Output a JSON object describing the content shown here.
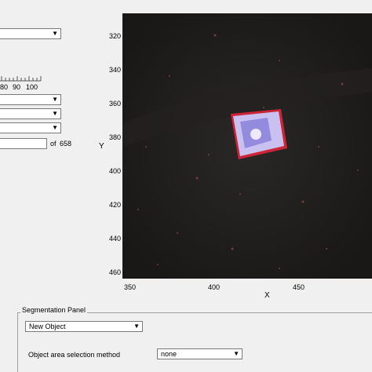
{
  "left_controls": {
    "dropdown1": {
      "value": "",
      "arrow": "▼"
    },
    "slider": {
      "tick_labels": [
        "80",
        "90",
        "100"
      ]
    },
    "dropdown2": {
      "value": "",
      "arrow": "▼"
    },
    "dropdown3": {
      "value": "",
      "arrow": "▼"
    },
    "dropdown4": {
      "value": "",
      "arrow": "▼"
    },
    "frame_input": {
      "value": "",
      "of_label": "of",
      "total": "658"
    }
  },
  "image_axes": {
    "y_label": "Y",
    "x_label": "X",
    "y_ticks": [
      "320",
      "340",
      "360",
      "380",
      "400",
      "420",
      "440",
      "460"
    ],
    "x_ticks": [
      "350",
      "400",
      "450"
    ]
  },
  "segmentation_panel": {
    "title": "Segmentation Panel",
    "object_dropdown": {
      "value": "New Object",
      "arrow": "▼"
    },
    "area_method_label": "Object area selection method",
    "area_method_dropdown": {
      "value": "none",
      "arrow": "▼"
    }
  },
  "colors": {
    "image_bg": "#1e1c1b",
    "object_outline": "#e0253a",
    "object_fill": "#c9c2f0"
  }
}
